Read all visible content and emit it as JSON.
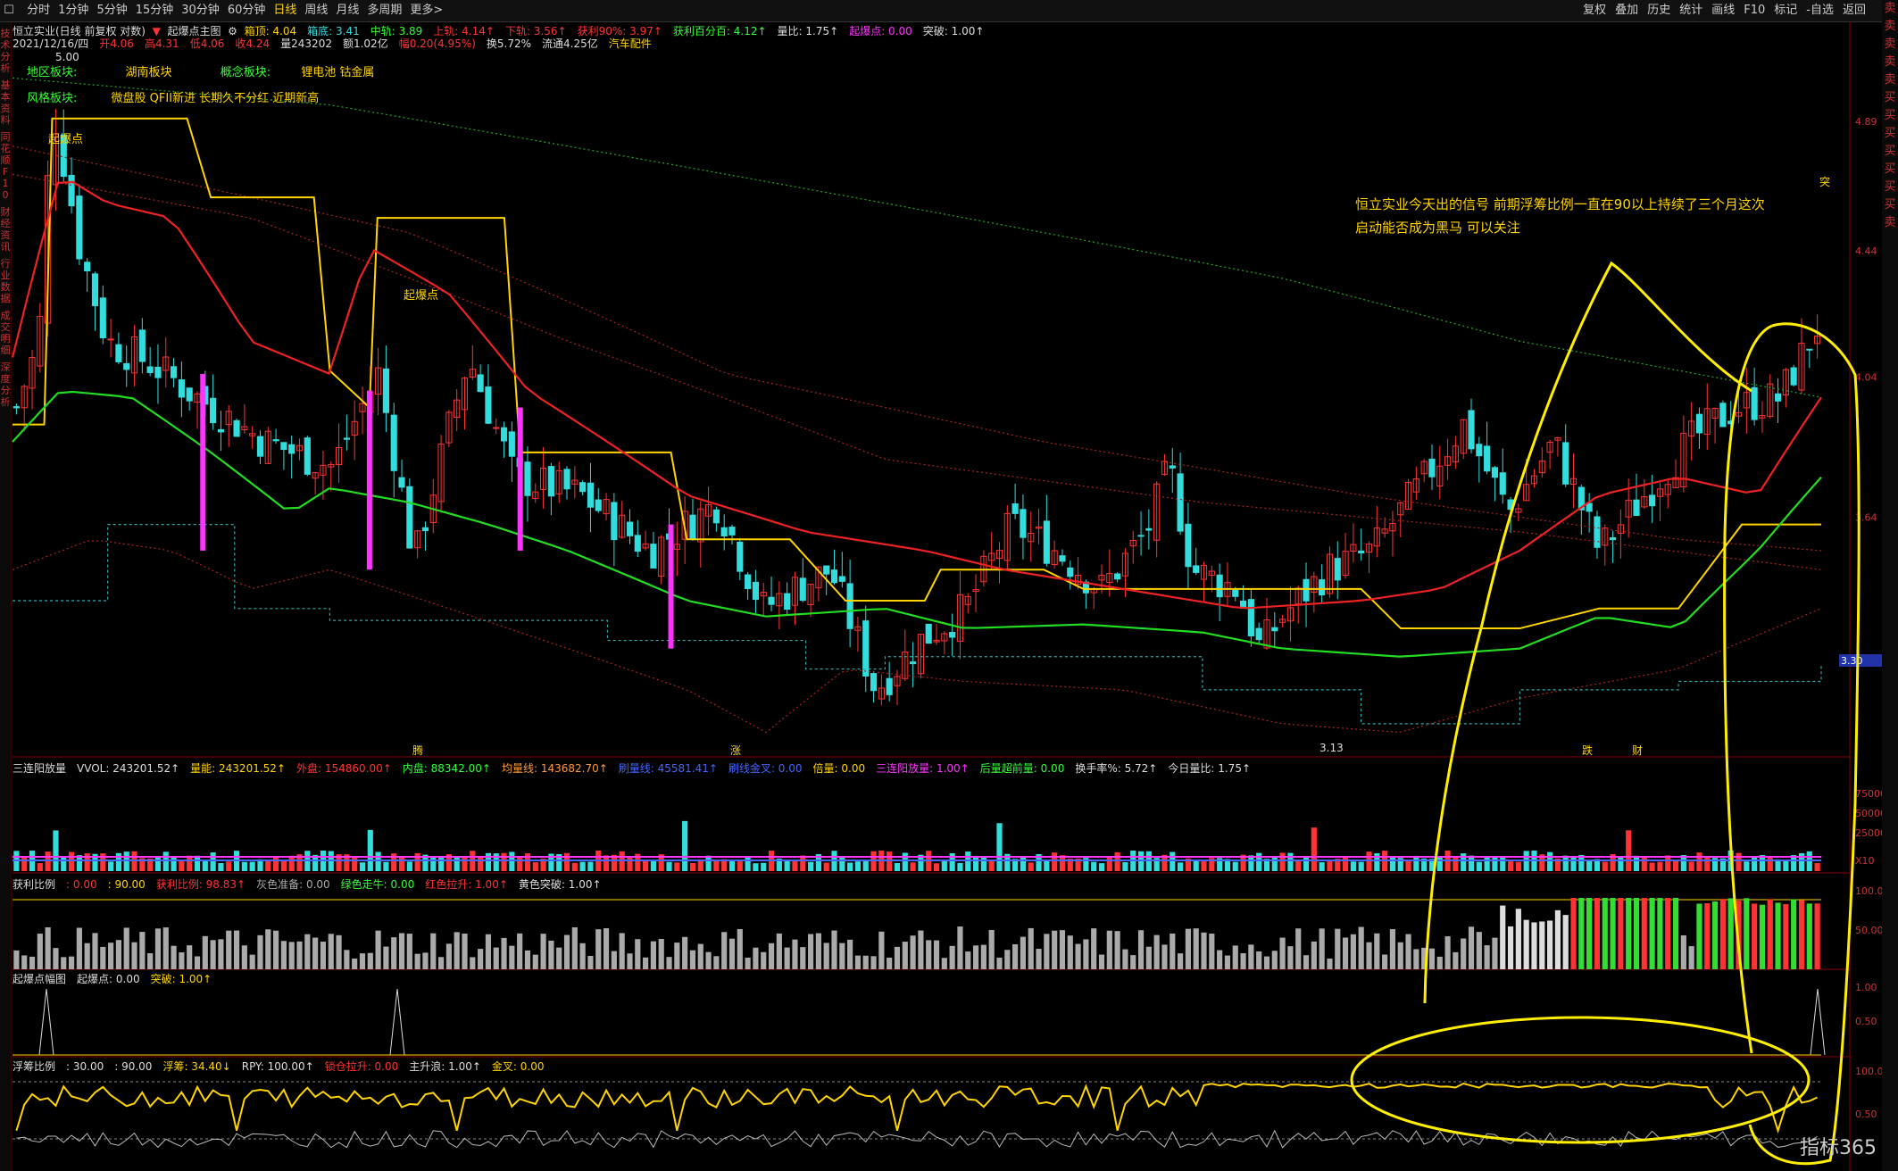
{
  "topbar": {
    "timeframes": [
      "分时",
      "1分钟",
      "5分钟",
      "15分钟",
      "30分钟",
      "60分钟",
      "日线",
      "周线",
      "月线",
      "多周期",
      "更多>"
    ],
    "active_index": 6,
    "right_menu": [
      "复权",
      "叠加",
      "历史",
      "统计",
      "画线",
      "F10",
      "标记",
      "-自选",
      "返回"
    ]
  },
  "left_strip": [
    "技术分析",
    "基本资料",
    "同花顺F10",
    "财经资讯",
    "行业数据",
    "成交明细",
    "深度分析"
  ],
  "right_strip": [
    "卖",
    "卖",
    "卖",
    "卖",
    "卖",
    "买",
    "买",
    "买",
    "买",
    "买",
    "买",
    "买",
    "卖"
  ],
  "header": {
    "title": "恒立实业(日线 前复权 对数)",
    "indicator": "起爆点主图",
    "items": [
      {
        "label": "箱顶: 4.04",
        "color": "#ffd400"
      },
      {
        "label": "箱底: 3.41",
        "color": "#33dddd"
      },
      {
        "label": "中轨: 3.89",
        "color": "#33ff33"
      },
      {
        "label": "上轨: 4.14↑",
        "color": "#ff3333"
      },
      {
        "label": "下轨: 3.56↑",
        "color": "#ff3333"
      },
      {
        "label": "获利90%: 3.97↑",
        "color": "#ff3333"
      },
      {
        "label": "获利百分百: 4.12↑",
        "color": "#33ff33"
      },
      {
        "label": "量比: 1.75↑",
        "color": "#dddddd"
      },
      {
        "label": "起爆点: 0.00",
        "color": "#ff33ff"
      },
      {
        "label": "突破: 1.00↑",
        "color": "#dddddd"
      }
    ],
    "line2": [
      {
        "label": "2021/12/16/四",
        "color": "#dddddd"
      },
      {
        "label": "开4.06",
        "color": "#ff3333"
      },
      {
        "label": "高4.31",
        "color": "#ff3333"
      },
      {
        "label": "低4.06",
        "color": "#ff3333"
      },
      {
        "label": "收4.24",
        "color": "#ff3333"
      },
      {
        "label": "量243202",
        "color": "#dddddd"
      },
      {
        "label": "额1.02亿",
        "color": "#dddddd"
      },
      {
        "label": "幅0.20(4.95%)",
        "color": "#ff3333"
      },
      {
        "label": "换5.72%",
        "color": "#dddddd"
      },
      {
        "label": "流通4.25亿",
        "color": "#dddddd"
      },
      {
        "label": "汽车配件",
        "color": "#ffd400"
      }
    ],
    "sector_labels": {
      "region_label": "地区板块:",
      "region_value": "湖南板块",
      "concept_label": "概念板块:",
      "concept_value": "锂电池 钴金属",
      "style_label": "风格板块:",
      "style_value": "微盘股 QFII新进 长期久不分红 近期新高"
    }
  },
  "annotation": {
    "line1": "恒立实业今天出的信号 前期浮筹比例一直在90以上持续了三个月这次",
    "line2": "启动能否成为黑马 可以关注"
  },
  "main_labels": {
    "high_label": "5.00",
    "low_label": "3.13",
    "qibao1": "起爆点",
    "qibao2": "起爆点",
    "price_tag": "3.30",
    "tu_label": "突",
    "yaxis": [
      "4.89",
      "4.44",
      "4.04",
      "3.64",
      "3.27"
    ],
    "bottom_marks": [
      "腾",
      "涨",
      "跌",
      "财"
    ]
  },
  "panel1": {
    "items": [
      {
        "label": "三连阳放量",
        "color": "#dddddd"
      },
      {
        "label": "VVOL: 243201.52↑",
        "color": "#dddddd"
      },
      {
        "label": "量能: 243201.52↑",
        "color": "#ffd400"
      },
      {
        "label": "外盘: 154860.00↑",
        "color": "#ff3333"
      },
      {
        "label": "内盘: 88342.00↑",
        "color": "#33ff33"
      },
      {
        "label": "均量线: 143682.70↑",
        "color": "#ff9933"
      },
      {
        "label": "刷量线: 45581.41↑",
        "color": "#4466ff"
      },
      {
        "label": "刷线金叉: 0.00",
        "color": "#4466ff"
      },
      {
        "label": "倍量: 0.00",
        "color": "#ffd400"
      },
      {
        "label": "三连阳放量: 1.00↑",
        "color": "#ff33ff"
      },
      {
        "label": "后量超前量: 0.00",
        "color": "#33ff33"
      },
      {
        "label": "换手率%: 5.72↑",
        "color": "#dddddd"
      },
      {
        "label": "今日量比: 1.75↑",
        "color": "#dddddd"
      }
    ],
    "yaxis": [
      "75000",
      "50000",
      "25000",
      "X10"
    ]
  },
  "panel2": {
    "items": [
      {
        "label": "获利比例",
        "color": "#dddddd"
      },
      {
        "label": ": 0.00",
        "color": "#ff3333"
      },
      {
        "label": ": 90.00",
        "color": "#ffd400"
      },
      {
        "label": "获利比例: 98.83↑",
        "color": "#ff3333"
      },
      {
        "label": "灰色准备: 0.00",
        "color": "#aaaaaa"
      },
      {
        "label": "绿色走牛: 0.00",
        "color": "#33ff33"
      },
      {
        "label": "红色拉升: 1.00↑",
        "color": "#ff3333"
      },
      {
        "label": "黄色突破: 1.00↑",
        "color": "#dddddd"
      }
    ],
    "yaxis": [
      "100.00",
      "50.00"
    ]
  },
  "panel3": {
    "items": [
      {
        "label": "起爆点幅图",
        "color": "#dddddd"
      },
      {
        "label": "起爆点: 0.00",
        "color": "#dddddd"
      },
      {
        "label": "突破: 1.00↑",
        "color": "#ffd400"
      }
    ],
    "yaxis": [
      "1.00",
      "0.50"
    ]
  },
  "panel4": {
    "items": [
      {
        "label": "浮筹比例",
        "color": "#dddddd"
      },
      {
        "label": ": 30.00",
        "color": "#dddddd"
      },
      {
        "label": ": 90.00",
        "color": "#dddddd"
      },
      {
        "label": "浮筹: 34.40↓",
        "color": "#ffd400"
      },
      {
        "label": "RPY: 100.00↑",
        "color": "#dddddd"
      },
      {
        "label": "锁仓拉升: 0.00",
        "color": "#ff3333"
      },
      {
        "label": "主升浪: 1.00↑",
        "color": "#dddddd"
      },
      {
        "label": "金叉: 0.00",
        "color": "#ffd400"
      }
    ],
    "yaxis": [
      "100.0",
      "0.50"
    ]
  },
  "logo": "指标365",
  "colors": {
    "up": "#ff3333",
    "down": "#33dddd",
    "yellow": "#ffd400",
    "green": "#22dd22",
    "red": "#ff2222",
    "magenta": "#ff33ff"
  },
  "chart_data": {
    "type": "candlestick",
    "price_axis": {
      "scale": "log",
      "range": [
        3.05,
        5.15
      ],
      "ticks": [
        4.89,
        4.44,
        4.04,
        3.64,
        3.27
      ]
    },
    "n_bars": 230,
    "close_path_anchors": [
      [
        0,
        3.95
      ],
      [
        5,
        4.15
      ],
      [
        8,
        4.95
      ],
      [
        14,
        4.45
      ],
      [
        20,
        4.15
      ],
      [
        30,
        4.08
      ],
      [
        40,
        3.98
      ],
      [
        55,
        3.85
      ],
      [
        70,
        3.78
      ],
      [
        80,
        4.05
      ],
      [
        88,
        3.52
      ],
      [
        100,
        4.1
      ],
      [
        110,
        3.75
      ],
      [
        125,
        3.7
      ],
      [
        140,
        3.55
      ],
      [
        155,
        3.68
      ],
      [
        165,
        3.4
      ],
      [
        172,
        3.45
      ],
      [
        180,
        3.5
      ],
      [
        190,
        3.2
      ],
      [
        200,
        3.32
      ],
      [
        210,
        3.4
      ],
      [
        220,
        3.62
      ],
      [
        230,
        3.55
      ],
      [
        240,
        3.45
      ],
      [
        250,
        3.6
      ],
      [
        255,
        3.78
      ],
      [
        260,
        3.5
      ],
      [
        270,
        3.45
      ],
      [
        275,
        3.3
      ],
      [
        280,
        3.38
      ],
      [
        290,
        3.5
      ],
      [
        300,
        3.55
      ],
      [
        310,
        3.72
      ],
      [
        320,
        3.9
      ],
      [
        330,
        3.65
      ],
      [
        340,
        3.85
      ],
      [
        350,
        3.55
      ],
      [
        360,
        3.7
      ],
      [
        370,
        3.85
      ],
      [
        380,
        3.95
      ],
      [
        390,
        3.98
      ],
      [
        400,
        4.24
      ]
    ],
    "box_top": [
      [
        0,
        3.9
      ],
      [
        4,
        3.9
      ],
      [
        5,
        4.9
      ],
      [
        22,
        4.9
      ],
      [
        25,
        4.62
      ],
      [
        38,
        4.62
      ],
      [
        40,
        4.06
      ],
      [
        45,
        3.95
      ],
      [
        46,
        4.55
      ],
      [
        62,
        4.55
      ],
      [
        64,
        3.82
      ],
      [
        83,
        3.82
      ],
      [
        85,
        3.58
      ],
      [
        98,
        3.58
      ],
      [
        105,
        3.42
      ],
      [
        115,
        3.42
      ],
      [
        117,
        3.5
      ],
      [
        130,
        3.5
      ],
      [
        135,
        3.45
      ],
      [
        170,
        3.45
      ],
      [
        175,
        3.35
      ],
      [
        190,
        3.35
      ],
      [
        200,
        3.4
      ],
      [
        210,
        3.4
      ],
      [
        218,
        3.62
      ],
      [
        228,
        3.62
      ]
    ],
    "box_bottom": [
      [
        0,
        3.42
      ],
      [
        10,
        3.42
      ],
      [
        12,
        3.62
      ],
      [
        25,
        3.62
      ],
      [
        28,
        3.4
      ],
      [
        38,
        3.4
      ],
      [
        40,
        3.37
      ],
      [
        70,
        3.37
      ],
      [
        75,
        3.32
      ],
      [
        100,
        3.25
      ],
      [
        110,
        3.28
      ],
      [
        150,
        3.2
      ],
      [
        170,
        3.12
      ],
      [
        185,
        3.12
      ],
      [
        190,
        3.2
      ],
      [
        210,
        3.22
      ],
      [
        228,
        3.26
      ]
    ],
    "ma_mid": [
      [
        0,
        3.85
      ],
      [
        6,
        4.0
      ],
      [
        15,
        3.98
      ],
      [
        25,
        3.82
      ],
      [
        35,
        3.65
      ],
      [
        40,
        3.72
      ],
      [
        50,
        3.68
      ],
      [
        60,
        3.62
      ],
      [
        70,
        3.55
      ],
      [
        85,
        3.42
      ],
      [
        95,
        3.38
      ],
      [
        110,
        3.4
      ],
      [
        120,
        3.35
      ],
      [
        135,
        3.36
      ],
      [
        150,
        3.34
      ],
      [
        160,
        3.3
      ],
      [
        175,
        3.28
      ],
      [
        190,
        3.3
      ],
      [
        200,
        3.38
      ],
      [
        210,
        3.35
      ],
      [
        220,
        3.55
      ],
      [
        228,
        3.75
      ]
    ],
    "ma_upper": [
      [
        0,
        4.1
      ],
      [
        6,
        4.7
      ],
      [
        12,
        4.6
      ],
      [
        20,
        4.55
      ],
      [
        30,
        4.15
      ],
      [
        40,
        4.05
      ],
      [
        45,
        4.45
      ],
      [
        55,
        4.3
      ],
      [
        65,
        4.0
      ],
      [
        75,
        3.85
      ],
      [
        85,
        3.7
      ],
      [
        100,
        3.6
      ],
      [
        115,
        3.55
      ],
      [
        125,
        3.5
      ],
      [
        140,
        3.45
      ],
      [
        155,
        3.4
      ],
      [
        170,
        3.42
      ],
      [
        180,
        3.45
      ],
      [
        190,
        3.55
      ],
      [
        200,
        3.7
      ],
      [
        210,
        3.75
      ],
      [
        220,
        3.7
      ],
      [
        228,
        3.98
      ]
    ],
    "ma_lower": [
      [
        0,
        3.5
      ],
      [
        10,
        3.58
      ],
      [
        20,
        3.55
      ],
      [
        30,
        3.45
      ],
      [
        40,
        3.5
      ],
      [
        55,
        3.4
      ],
      [
        70,
        3.3
      ],
      [
        85,
        3.2
      ],
      [
        95,
        3.1
      ],
      [
        105,
        3.25
      ],
      [
        120,
        3.22
      ],
      [
        140,
        3.2
      ],
      [
        160,
        3.12
      ],
      [
        175,
        3.1
      ],
      [
        190,
        3.18
      ],
      [
        210,
        3.25
      ],
      [
        228,
        3.4
      ]
    ],
    "long_red": [
      [
        0,
        4.7
      ],
      [
        30,
        4.55
      ],
      [
        70,
        4.15
      ],
      [
        110,
        3.8
      ],
      [
        150,
        3.68
      ],
      [
        190,
        3.6
      ],
      [
        228,
        3.5
      ]
    ],
    "long_green": [
      [
        0,
        5.05
      ],
      [
        40,
        4.95
      ],
      [
        80,
        4.75
      ],
      [
        120,
        4.55
      ],
      [
        160,
        4.35
      ],
      [
        190,
        4.15
      ],
      [
        228,
        3.98
      ]
    ],
    "long_red2": [
      [
        0,
        4.8
      ],
      [
        50,
        4.5
      ],
      [
        90,
        4.05
      ],
      [
        130,
        3.85
      ],
      [
        170,
        3.7
      ],
      [
        210,
        3.58
      ],
      [
        228,
        3.55
      ]
    ],
    "rays": [
      [
        0,
        3.42
      ],
      [
        45,
        3.42
      ],
      [
        90,
        3.25
      ],
      [
        150,
        3.2
      ],
      [
        175,
        3.12
      ],
      [
        228,
        3.3
      ]
    ]
  }
}
